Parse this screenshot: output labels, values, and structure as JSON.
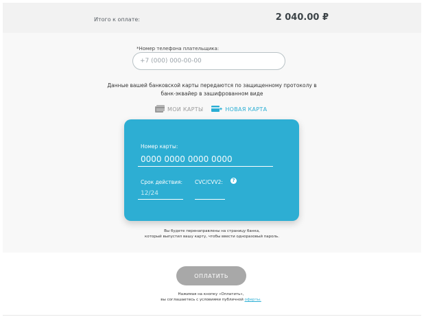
{
  "summary": {
    "label": "Итого к оплате:",
    "amount": "2 040.00 ₽"
  },
  "phone": {
    "label": "*Номер телефона плательщика:",
    "placeholder": "+7 (000) 000-00-00"
  },
  "secure_note": {
    "line1": "Данные вашей банковской карты передаются по защищенному протоколу в",
    "line2": "банк-эквайер в зашифрованном виде"
  },
  "tabs": {
    "my_cards": "МОИ КАРТЫ",
    "new_card": "НОВАЯ КАРТА",
    "my_cards_icon": "saved-cards-icon",
    "new_card_icon": "add-card-icon"
  },
  "card_form": {
    "number_label": "Номер карты:",
    "number_placeholder": "0000 0000 0000 0000",
    "expiry_label": "Срок действия:",
    "expiry_placeholder": "12/24",
    "cvc_label": "CVC/CVV2:",
    "cvc_help": "?"
  },
  "redirect_note": {
    "line1": "Вы будете перенаправлены на страницу банка,",
    "line2": "который выпустил вашу карту, чтобы ввести одноразовый пароль."
  },
  "pay_button": {
    "label": "ОПЛАТИТЬ"
  },
  "terms": {
    "line1": "Нажимая на кнопку «Оплатить»,",
    "line2_prefix": "вы соглашаетесь с условиями публичной ",
    "offer_link": "оферты."
  },
  "colors": {
    "accent": "#2daed3",
    "button_disabled": "#a8a8a8"
  }
}
